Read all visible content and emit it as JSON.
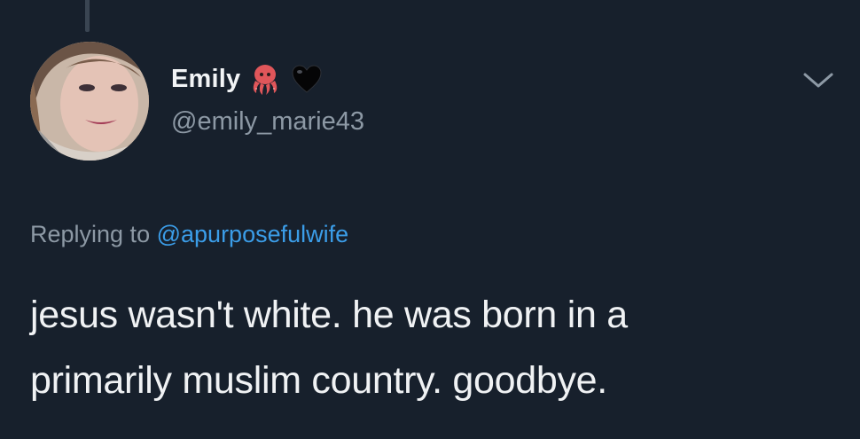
{
  "tweet": {
    "display_name": "Emily",
    "handle": "@emily_marie43",
    "name_emojis": [
      "octopus-icon",
      "black-heart-icon"
    ],
    "replying_prefix": "Replying to",
    "replying_to": "@apurposefulwife",
    "text_lines": [
      "jesus wasn't white. he was born in a",
      "primarily muslim country. goodbye."
    ]
  },
  "colors": {
    "background": "#17202c",
    "primary_text": "#f0f2f4",
    "secondary_text": "#8d99a5",
    "link": "#3b9de8",
    "octopus": "#e0565a"
  }
}
